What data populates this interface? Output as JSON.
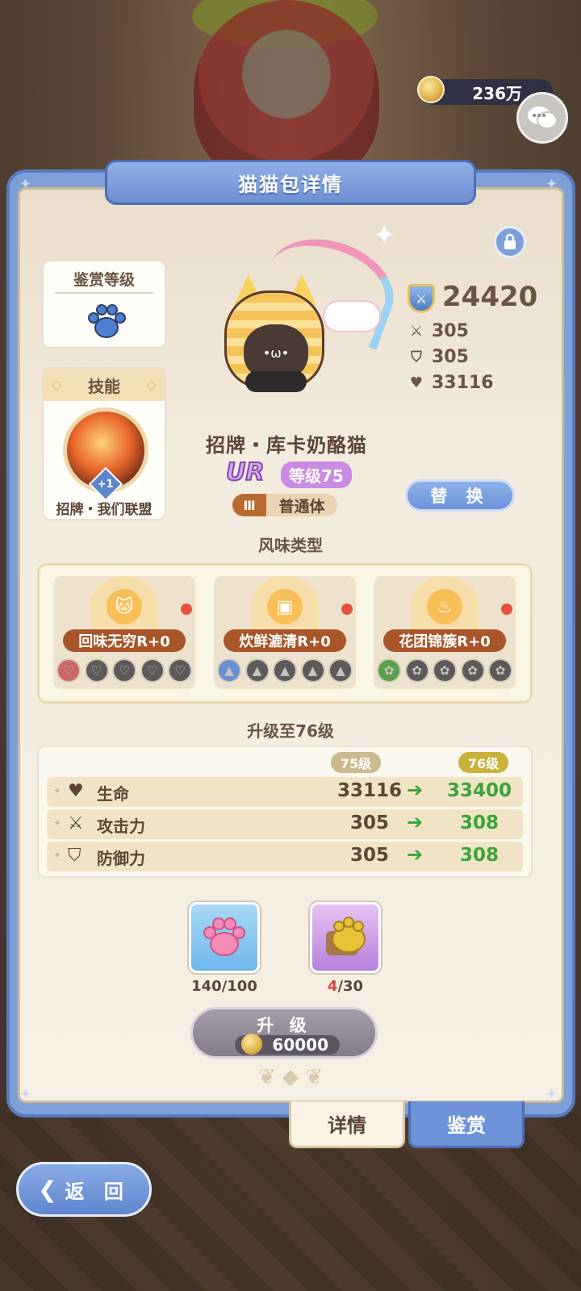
{
  "header": {
    "currency_value": "236万",
    "currency_icon": "gold-coin-icon",
    "chat_icon": "chat-bubbles-icon"
  },
  "panel": {
    "title": "猫猫包详情",
    "lock_icon": "lock-icon"
  },
  "appraisal": {
    "title": "鉴赏等级",
    "badge_icon": "blue-paw-icon"
  },
  "skill": {
    "title": "技能",
    "badge": "+1",
    "name": "招牌・我们联盟"
  },
  "character": {
    "name": "招牌・库卡奶酪猫",
    "rarity": "UR",
    "level": "等级75",
    "grade": "Ⅲ",
    "type": "普通体",
    "replace_label": "替 换"
  },
  "stats": {
    "power": "24420",
    "attack": "305",
    "defense": "305",
    "health": "33116"
  },
  "flavor": {
    "title": "风味类型",
    "items": [
      {
        "label": "回味无穷R+0",
        "emblem": "cat-face-icon",
        "gem_icon": "heart-gem-icon"
      },
      {
        "label": "炊鲜漉清R+0",
        "emblem": "bento-icon",
        "gem_icon": "triangle-gem-icon"
      },
      {
        "label": "花团锦簇R+0",
        "emblem": "flame-icon",
        "gem_icon": "paw-gem-icon"
      }
    ]
  },
  "upgrade": {
    "title": "升级至76级",
    "from_level": "75级",
    "to_level": "76级",
    "rows": [
      {
        "label": "生命",
        "icon": "heart-icon",
        "current": "33116",
        "next": "33400"
      },
      {
        "label": "攻击力",
        "icon": "swords-icon",
        "current": "305",
        "next": "308"
      },
      {
        "label": "防御力",
        "icon": "shield-icon",
        "current": "305",
        "next": "308"
      }
    ],
    "materials": [
      {
        "icon": "pink-paw-jelly-icon",
        "have": "140",
        "need": "/100"
      },
      {
        "icon": "golden-paw-bread-icon",
        "have": "4",
        "need": "/30"
      }
    ],
    "button_label": "升 级",
    "cost": "60000"
  },
  "tabs": {
    "detail": "详情",
    "appraise": "鉴赏"
  },
  "back_label": "返 回",
  "colors": {
    "panel_blue": "#7ea0d8",
    "accent_green": "#39a43a",
    "warning_red": "#d8433a",
    "rarity_purple": "#c98be3"
  }
}
